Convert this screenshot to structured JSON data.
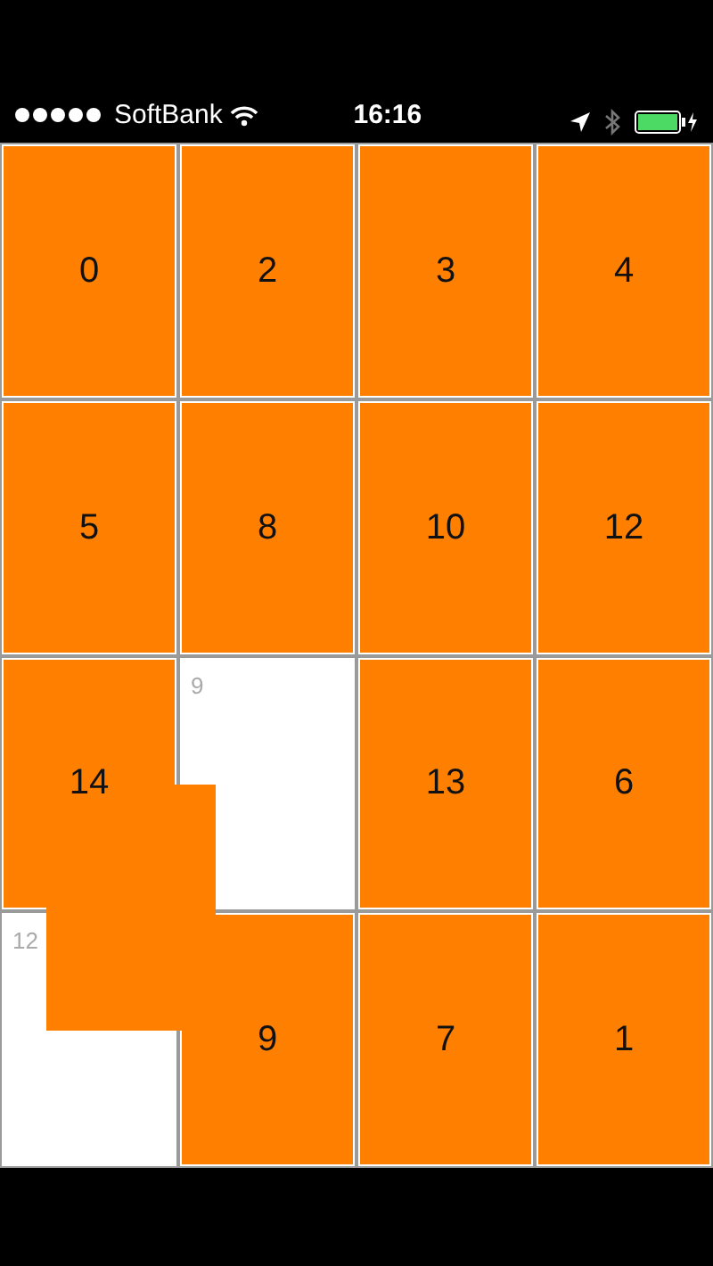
{
  "status_bar": {
    "carrier": "SoftBank",
    "time": "16:16"
  },
  "tiles": [
    {
      "kind": "tile",
      "label": "0"
    },
    {
      "kind": "tile",
      "label": "2"
    },
    {
      "kind": "tile",
      "label": "3"
    },
    {
      "kind": "tile",
      "label": "4"
    },
    {
      "kind": "tile",
      "label": "5"
    },
    {
      "kind": "tile",
      "label": "8"
    },
    {
      "kind": "tile",
      "label": "10"
    },
    {
      "kind": "tile",
      "label": "12"
    },
    {
      "kind": "tile",
      "label": "14"
    },
    {
      "kind": "empty",
      "label": "9"
    },
    {
      "kind": "tile",
      "label": "13"
    },
    {
      "kind": "tile",
      "label": "6"
    },
    {
      "kind": "empty",
      "label": "12"
    },
    {
      "kind": "tile",
      "label": "9"
    },
    {
      "kind": "tile",
      "label": "7"
    },
    {
      "kind": "tile",
      "label": "1"
    }
  ],
  "dragged_tile": {
    "visible": true
  }
}
